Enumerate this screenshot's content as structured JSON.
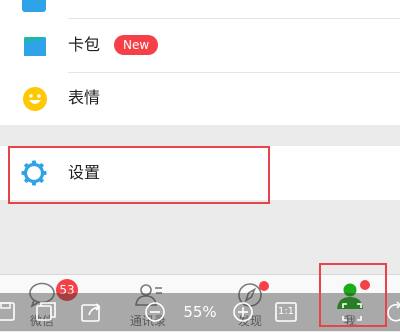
{
  "menu": {
    "kabao_label": "卡包",
    "kabao_badge": "New",
    "biaoqing_label": "表情",
    "settings_label": "设置"
  },
  "tabbar": {
    "chats_label": "微信",
    "chats_badge": "53",
    "contacts_label": "通讯录",
    "discover_label": "发现",
    "me_label": "我"
  },
  "viewer": {
    "zoom_label": "55%",
    "actual_size_label": "1:1"
  },
  "colors": {
    "accent_blue": "#2ea3e8",
    "badge_red": "#f44046",
    "me_green": "#1aad19",
    "annotation_red": "#e8434b"
  }
}
